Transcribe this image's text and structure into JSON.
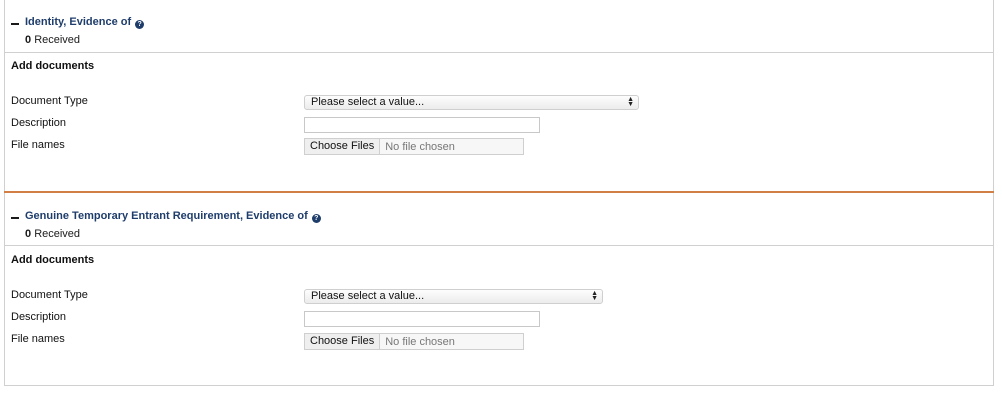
{
  "sections": [
    {
      "title": "Identity, Evidence of",
      "received_count": "0",
      "received_label": "Received",
      "add_documents_label": "Add documents",
      "fields": {
        "document_type_label": "Document Type",
        "document_type_value": "Please select a value...",
        "description_label": "Description",
        "description_value": "",
        "file_names_label": "File names",
        "choose_files_label": "Choose Files",
        "no_file_label": "No file chosen"
      }
    },
    {
      "title": "Genuine Temporary Entrant Requirement, Evidence of",
      "received_count": "0",
      "received_label": "Received",
      "add_documents_label": "Add documents",
      "fields": {
        "document_type_label": "Document Type",
        "document_type_value": "Please select a value...",
        "description_label": "Description",
        "description_value": "",
        "file_names_label": "File names",
        "choose_files_label": "Choose Files",
        "no_file_label": "No file chosen"
      }
    }
  ],
  "icons": {
    "collapse": "minus-icon",
    "help": "question-circle-icon",
    "select_arrows": "up-down-arrows-icon"
  },
  "colors": {
    "title": "#1f3d6b",
    "divider": "#d27f45",
    "border": "#d0d0d0"
  }
}
